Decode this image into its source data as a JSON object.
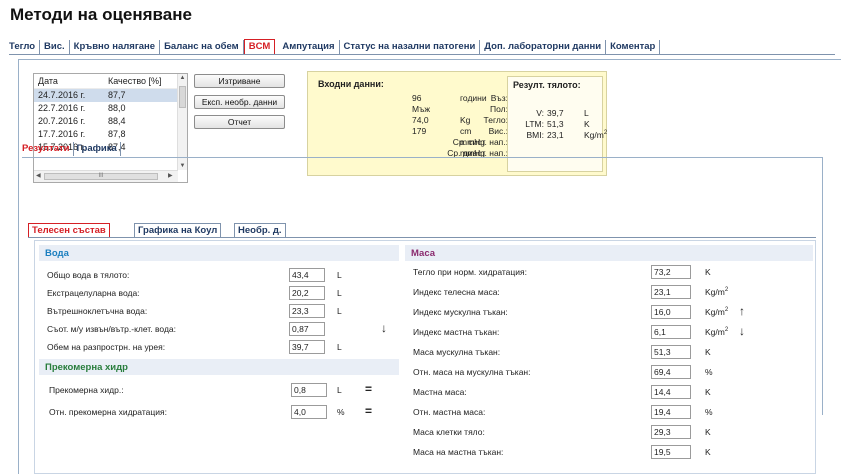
{
  "page": {
    "title": "Методи на оценяване"
  },
  "tabs": [
    {
      "label": "Тегло"
    },
    {
      "label": "Вис."
    },
    {
      "label": "Кръвно налягане"
    },
    {
      "label": "Баланс на обем"
    },
    {
      "label": "BCM"
    },
    {
      "label": "Ампутация"
    },
    {
      "label": "Статус на назални патогени"
    },
    {
      "label": "Доп. лабораторни данни"
    },
    {
      "label": "Коментар"
    }
  ],
  "list": {
    "col_date": "Дата",
    "col_quality": "Качество [%]",
    "rows": [
      {
        "date": "24.7.2016 г.",
        "q": "87,7"
      },
      {
        "date": "22.7.2016 г.",
        "q": "88,0"
      },
      {
        "date": "20.7.2016 г.",
        "q": "88,4"
      },
      {
        "date": "17.7.2016 г.",
        "q": "87,8"
      },
      {
        "date": "15.7.2016 г.",
        "q": "87,4"
      }
    ],
    "hscroll_mark": "III"
  },
  "buttons": {
    "delete": "Изтриване",
    "export": "Експ. необр. данни",
    "report": "Отчет"
  },
  "input": {
    "title": "Входни данни:",
    "rows": [
      {
        "label": "Въз:",
        "value": "96",
        "unit": "години"
      },
      {
        "label": "Пол:",
        "value": "Мъж",
        "unit": ""
      },
      {
        "label": "Тегло:",
        "value": "74,0",
        "unit": "Kg"
      },
      {
        "label": "Вис.:",
        "value": "179",
        "unit": "cm"
      },
      {
        "label": "Ср. сист. нап.:",
        "value": "",
        "unit": "mmHg"
      },
      {
        "label": "Ср. диаст. нап.:",
        "value": "",
        "unit": "mmHg"
      }
    ]
  },
  "result": {
    "title": "Резулт. тялото:",
    "rows": [
      {
        "label": "V:",
        "value": "39,7",
        "unit": "L",
        "sup": ""
      },
      {
        "label": "LTM:",
        "value": "51,3",
        "unit": "K",
        "sup": ""
      },
      {
        "label": "BMI:",
        "value": "23,1",
        "unit": "Kg/m",
        "sup": "2"
      }
    ]
  },
  "subtabs": [
    {
      "label": "Резултати"
    },
    {
      "label": "Графика"
    }
  ],
  "subsubtabs": [
    {
      "label": "Телесен състав"
    },
    {
      "label": "Графика на Коул"
    },
    {
      "label": "Необр. д."
    }
  ],
  "water": {
    "title": "Вода",
    "rows": [
      {
        "label": "Общо вода в тялото:",
        "value": "43,4",
        "unit": "L",
        "arrow": ""
      },
      {
        "label": "Екстрацелуларна вода:",
        "value": "20,2",
        "unit": "L",
        "arrow": ""
      },
      {
        "label": "Вътрешноклетъчна вода:",
        "value": "23,3",
        "unit": "L",
        "arrow": ""
      },
      {
        "label": "Съот. м/у извън/вътр.-клет. вода:",
        "value": "0,87",
        "unit": "",
        "arrow": "↓"
      },
      {
        "label": "Обем на разпрострн. на урея:",
        "value": "39,7",
        "unit": "L",
        "arrow": ""
      }
    ]
  },
  "overhyd": {
    "title": "Прекомерна хидр",
    "rows": [
      {
        "label": "Прекомерна хидр.:",
        "value": "0,8",
        "unit": "L",
        "sym": "="
      },
      {
        "label": "Отн. прекомерна хидратация:",
        "value": "4,0",
        "unit": "%",
        "sym": "="
      }
    ]
  },
  "mass": {
    "title": "Маса",
    "rows": [
      {
        "label": "Тегло при норм. хидратация:",
        "value": "73,2",
        "unit": "K",
        "sup": "",
        "arrow": ""
      },
      {
        "label": "Индекс телесна маса:",
        "value": "23,1",
        "unit": "Kg/m",
        "sup": "2",
        "arrow": ""
      },
      {
        "label": "Индекс мускулна тъкан:",
        "value": "16,0",
        "unit": "Kg/m",
        "sup": "2",
        "arrow": "↑"
      },
      {
        "label": "Индекс мастна тъкан:",
        "value": "6,1",
        "unit": "Kg/m",
        "sup": "2",
        "arrow": "↓"
      },
      {
        "label": "Маса мускулна тъкан:",
        "value": "51,3",
        "unit": "K",
        "sup": "",
        "arrow": ""
      },
      {
        "label": "Отн. маса на мускулна тъкан:",
        "value": "69,4",
        "unit": "%",
        "sup": "",
        "arrow": ""
      },
      {
        "label": "Мастна маса:",
        "value": "14,4",
        "unit": "K",
        "sup": "",
        "arrow": ""
      },
      {
        "label": "Отн. мастна маса:",
        "value": "19,4",
        "unit": "%",
        "sup": "",
        "arrow": ""
      },
      {
        "label": "Маса клетки тяло:",
        "value": "29,3",
        "unit": "K",
        "sup": "",
        "arrow": ""
      },
      {
        "label": "Маса на мастна тъкан:",
        "value": "19,5",
        "unit": "K",
        "sup": "",
        "arrow": ""
      }
    ]
  }
}
